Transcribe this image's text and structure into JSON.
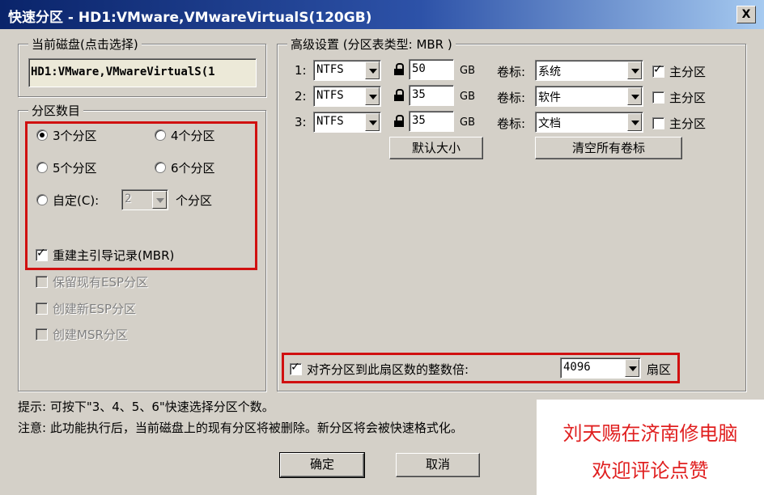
{
  "window": {
    "title": "快速分区 - HD1:VMware,VMwareVirtualS(120GB)",
    "close_label": "X"
  },
  "current_disk": {
    "group_label": "当前磁盘(点击选择)",
    "value": "HD1:VMware,VMwareVirtualS(1"
  },
  "partition_count": {
    "group_label": "分区数目",
    "options": [
      {
        "label": "3个分区",
        "checked": true
      },
      {
        "label": "4个分区",
        "checked": false
      },
      {
        "label": "5个分区",
        "checked": false
      },
      {
        "label": "6个分区",
        "checked": false
      }
    ],
    "custom_label": "自定(C):",
    "custom_value": "2",
    "custom_suffix": "个分区",
    "rebuild_mbr_label": "重建主引导记录(MBR)",
    "keep_esp_label": "保留现有ESP分区",
    "create_esp_label": "创建新ESP分区",
    "create_msr_label": "创建MSR分区"
  },
  "advanced": {
    "group_label": "高级设置 (分区表类型: MBR )",
    "rows": [
      {
        "index": "1:",
        "fs": "NTFS",
        "size": "50",
        "unit": "GB",
        "label_caption": "卷标:",
        "volume": "系统",
        "primary_label": "主分区",
        "primary_checked": true
      },
      {
        "index": "2:",
        "fs": "NTFS",
        "size": "35",
        "unit": "GB",
        "label_caption": "卷标:",
        "volume": "软件",
        "primary_label": "主分区",
        "primary_checked": false
      },
      {
        "index": "3:",
        "fs": "NTFS",
        "size": "35",
        "unit": "GB",
        "label_caption": "卷标:",
        "volume": "文档",
        "primary_label": "主分区",
        "primary_checked": false
      }
    ],
    "default_size_label": "默认大小",
    "clear_labels_label": "清空所有卷标",
    "align_label": "对齐分区到此扇区数的整数倍:",
    "align_value": "4096",
    "align_unit": "扇区"
  },
  "hints": {
    "tip": "提示: 可按下\"3、4、5、6\"快速选择分区个数。",
    "note": "注意: 此功能执行后，当前磁盘上的现有分区将被删除。新分区将会被快速格式化。"
  },
  "buttons": {
    "ok": "确定",
    "cancel": "取消"
  },
  "watermark": {
    "line1": "刘天赐在济南修电脑",
    "line2": "欢迎评论点赞"
  },
  "colors": {
    "highlight_box": "#d01010",
    "title_bar": "#0a246a",
    "watermark_text": "#e02020"
  }
}
